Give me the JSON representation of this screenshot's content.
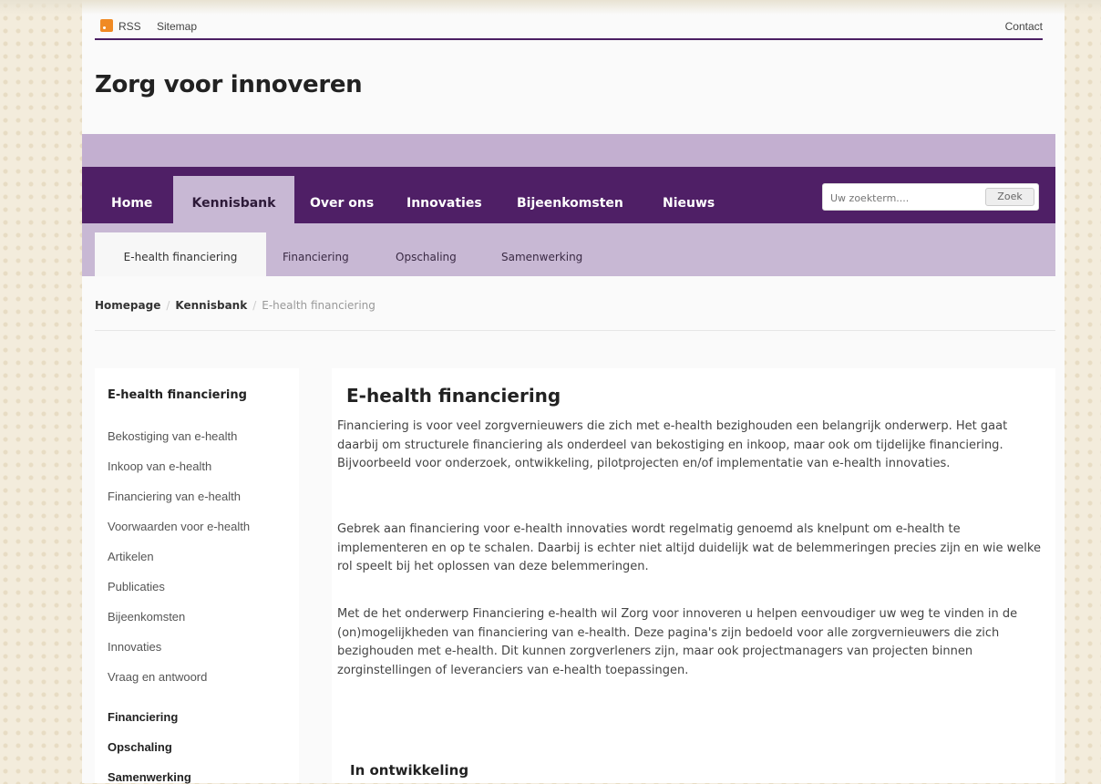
{
  "topbar": {
    "rss": "RSS",
    "sitemap": "Sitemap",
    "contact": "Contact"
  },
  "site_title": "Zorg voor innoveren",
  "nav": {
    "items": [
      "Home",
      "Kennisbank",
      "Over ons",
      "Innovaties",
      "Bijeenkomsten",
      "Nieuws"
    ],
    "active": "Kennisbank",
    "search_placeholder": "Uw zoekterm....",
    "search_button": "Zoek"
  },
  "subnav": {
    "items": [
      "E-health financiering",
      "Financiering",
      "Opschaling",
      "Samenwerking"
    ],
    "active": "E-health financiering"
  },
  "breadcrumb": [
    "Homepage",
    "Kennisbank",
    "E-health financiering"
  ],
  "sidebar": {
    "heading": "E-health financiering",
    "items": [
      "Bekostiging van e-health",
      "Inkoop van e-health",
      "Financiering van e-health",
      "Voorwaarden voor e-health",
      "Artikelen",
      "Publicaties",
      "Bijeenkomsten",
      "Innovaties",
      "Vraag en antwoord"
    ],
    "sections": [
      "Financiering",
      "Opschaling",
      "Samenwerking"
    ]
  },
  "content": {
    "title": "E-health financiering",
    "paragraphs": [
      "Financiering is voor veel zorgvernieuwers die zich met e-health bezighouden een belangrijk onderwerp. Het gaat daarbij om structurele financiering als onderdeel van bekostiging en inkoop, maar ook om tijdelijke financiering. Bijvoorbeeld voor onderzoek, ontwikkeling, pilotprojecten en/of implementatie van e-health innovaties.",
      "Gebrek aan financiering voor e-health innovaties wordt regelmatig genoemd als knelpunt om e-health te implementeren en op te schalen. Daarbij is echter niet altijd duidelijk wat de belemmeringen precies zijn en wie welke rol speelt bij het oplossen van deze belemmeringen.",
      "Met de het onderwerp Financiering e-health wil Zorg voor innoveren u helpen eenvoudiger uw weg te vinden in de (on)mogelijkheden van financiering van e-health. Deze pagina's zijn bedoeld voor alle zorgvernieuwers die zich bezighouden met e-health. Dit kunnen zorgverleners zijn, maar ook projectmanagers van projecten binnen zorginstellingen of leveranciers van e-health toepassingen."
    ],
    "subheading": "In ontwikkeling"
  }
}
